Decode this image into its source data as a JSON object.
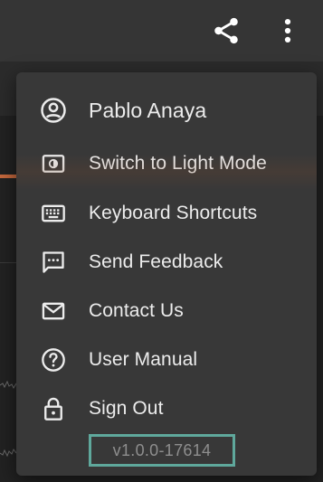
{
  "toolbar": {
    "share_icon": "share-icon",
    "more_icon": "more-vertical-icon"
  },
  "menu": {
    "items": [
      {
        "label": "Pablo Anaya",
        "icon": "account-circle-icon"
      },
      {
        "label": "Switch to Light Mode",
        "icon": "theme-toggle-icon"
      },
      {
        "label": "Keyboard Shortcuts",
        "icon": "keyboard-icon"
      },
      {
        "label": "Send Feedback",
        "icon": "feedback-icon"
      },
      {
        "label": "Contact Us",
        "icon": "mail-icon"
      },
      {
        "label": "User Manual",
        "icon": "help-icon"
      },
      {
        "label": "Sign Out",
        "icon": "lock-icon"
      }
    ],
    "version": "v1.0.0-17614"
  },
  "colors": {
    "toolbar_bg": "#353535",
    "menu_bg": "#383838",
    "text": "#ececec",
    "version_border": "#5fa89c",
    "version_text": "#8e8e8e"
  }
}
